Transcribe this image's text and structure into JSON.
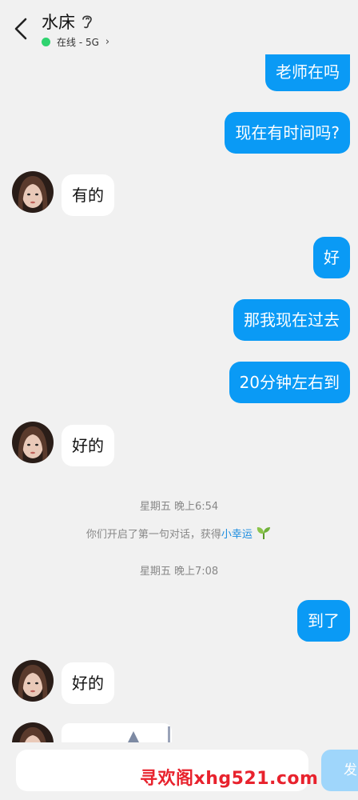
{
  "header": {
    "contact_name": "水床",
    "status_text": "在线 - 5G",
    "status_color": "#2fd36f"
  },
  "messages": [
    {
      "side": "out",
      "text": "老师在吗"
    },
    {
      "side": "out",
      "text": "现在有时间吗?"
    },
    {
      "side": "in",
      "text": "有的"
    },
    {
      "side": "out",
      "text": "好"
    },
    {
      "side": "out",
      "text": "那我现在过去"
    },
    {
      "side": "out",
      "text": "20分钟左右到"
    },
    {
      "side": "in",
      "text": "好的"
    },
    {
      "side": "system_time",
      "text": "星期五 晚上6:54"
    },
    {
      "side": "system_notice",
      "text": "你们开启了第一句对话，获得",
      "link": "小幸运"
    },
    {
      "side": "system_time",
      "text": "星期五 晚上7:08"
    },
    {
      "side": "out",
      "text": "到了"
    },
    {
      "side": "in",
      "text": "好的"
    }
  ],
  "composer": {
    "send_label": "发"
  },
  "watermark": "寻欢阁xhg521.com",
  "colors": {
    "outgoing_bubble": "#0a9af5",
    "incoming_bubble": "#ffffff",
    "background": "#f1f1f1",
    "link": "#1a8ce0"
  }
}
